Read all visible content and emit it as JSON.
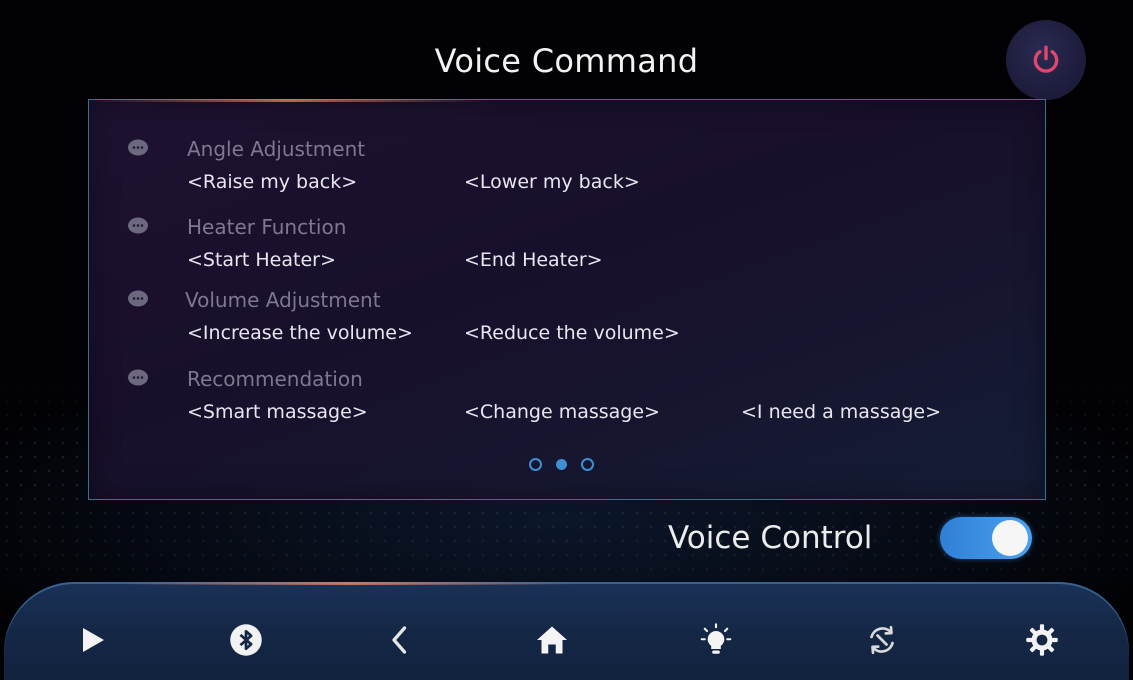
{
  "header": {
    "title": "Voice Command",
    "power_icon": "power-icon",
    "power_color": "#e2466e"
  },
  "panel": {
    "groups": [
      {
        "title": "Angle Adjustment",
        "commands": [
          "<Raise my back>",
          "<Lower my back>"
        ]
      },
      {
        "title": "Heater Function",
        "commands": [
          "<Start Heater>",
          "<End Heater>"
        ]
      },
      {
        "title": "Volume Adjustment",
        "commands": [
          "<Increase the volume>",
          "<Reduce the volume>"
        ]
      },
      {
        "title": "Recommendation",
        "commands": [
          "<Smart massage>",
          "<Change massage>",
          "<I need a massage>"
        ]
      }
    ],
    "pager": {
      "pages": 3,
      "active_index": 1
    }
  },
  "voice_control": {
    "label": "Voice Control",
    "enabled": true,
    "accent": "#3f8fd0"
  },
  "dock": {
    "items": [
      {
        "icon": "play-icon"
      },
      {
        "icon": "bluetooth-icon"
      },
      {
        "icon": "back-chevron-icon"
      },
      {
        "icon": "home-icon"
      },
      {
        "icon": "light-bulb-icon"
      },
      {
        "icon": "sync-icon"
      },
      {
        "icon": "settings-gear-icon"
      }
    ]
  }
}
